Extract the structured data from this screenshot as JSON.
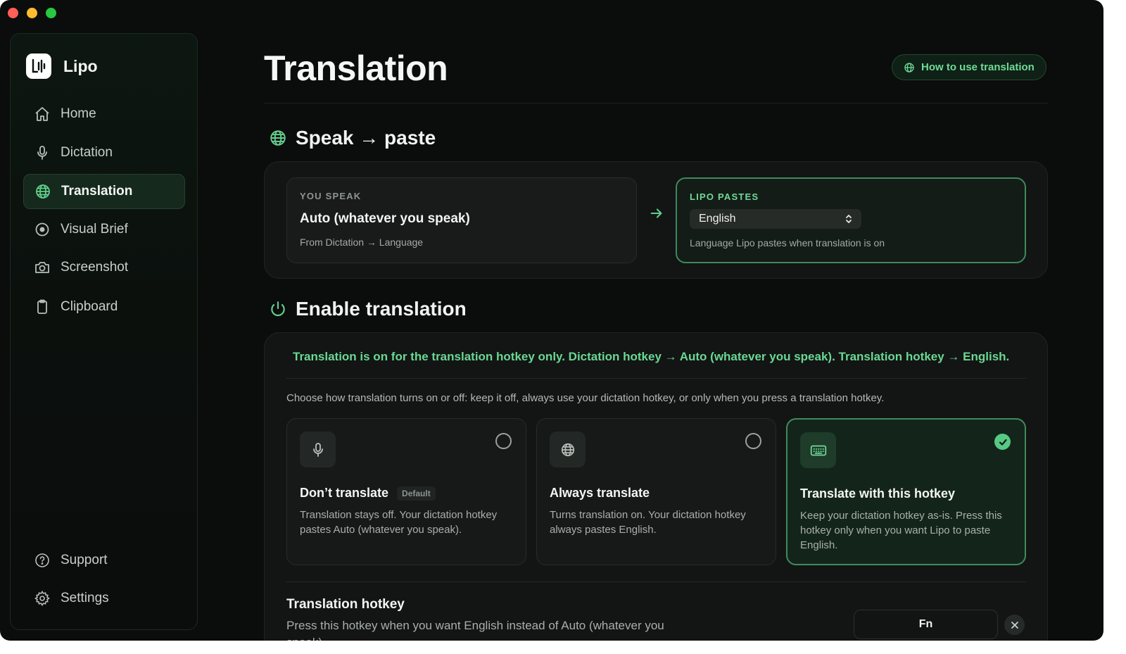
{
  "app": {
    "name": "Lipo"
  },
  "sidebar": {
    "items": [
      {
        "label": "Home",
        "icon": "home-icon"
      },
      {
        "label": "Dictation",
        "icon": "microphone-icon"
      },
      {
        "label": "Translation",
        "icon": "globe-icon",
        "active": true
      },
      {
        "label": "Visual Brief",
        "icon": "record-icon"
      },
      {
        "label": "Screenshot",
        "icon": "camera-icon"
      },
      {
        "label": "Clipboard",
        "icon": "clipboard-icon"
      }
    ],
    "footer": [
      {
        "label": "Support",
        "icon": "help-circle-icon"
      },
      {
        "label": "Settings",
        "icon": "gear-icon"
      }
    ]
  },
  "header": {
    "title": "Translation",
    "help_button": "How to use translation"
  },
  "speak_paste": {
    "heading": "Speak → paste",
    "you_speak": {
      "label": "YOU SPEAK",
      "value": "Auto (whatever you speak)",
      "sub": "From Dictation → Language"
    },
    "lipo_pastes": {
      "label": "LIPO PASTES",
      "selected": "English",
      "sub": "Language Lipo pastes when translation is on"
    }
  },
  "enable": {
    "heading": "Enable translation",
    "status": "Translation is on for the translation hotkey only. Dictation hotkey → Auto (whatever you speak). Translation hotkey → English.",
    "description": "Choose how translation turns on or off: keep it off, always use your dictation hotkey, or only when you press a translation hotkey.",
    "options": [
      {
        "title": "Don’t translate",
        "badge": "Default",
        "desc": "Translation stays off. Your dictation hotkey pastes Auto (whatever you speak).",
        "icon": "microphone-icon",
        "selected": false
      },
      {
        "title": "Always translate",
        "badge": "",
        "desc": "Turns translation on. Your dictation hotkey always pastes English.",
        "icon": "globe-icon",
        "selected": false
      },
      {
        "title": "Translate with this hotkey",
        "badge": "",
        "desc": "Keep your dictation hotkey as-is. Press this hotkey only when you want Lipo to paste English.",
        "icon": "keyboard-icon",
        "selected": true
      }
    ],
    "hotkey": {
      "title": "Translation hotkey",
      "desc": "Press this hotkey when you want English instead of Auto (whatever you speak).",
      "key": "Fn"
    }
  },
  "colors": {
    "accent": "#62cf8c",
    "background": "#0b0c0c",
    "card": "#121514"
  }
}
